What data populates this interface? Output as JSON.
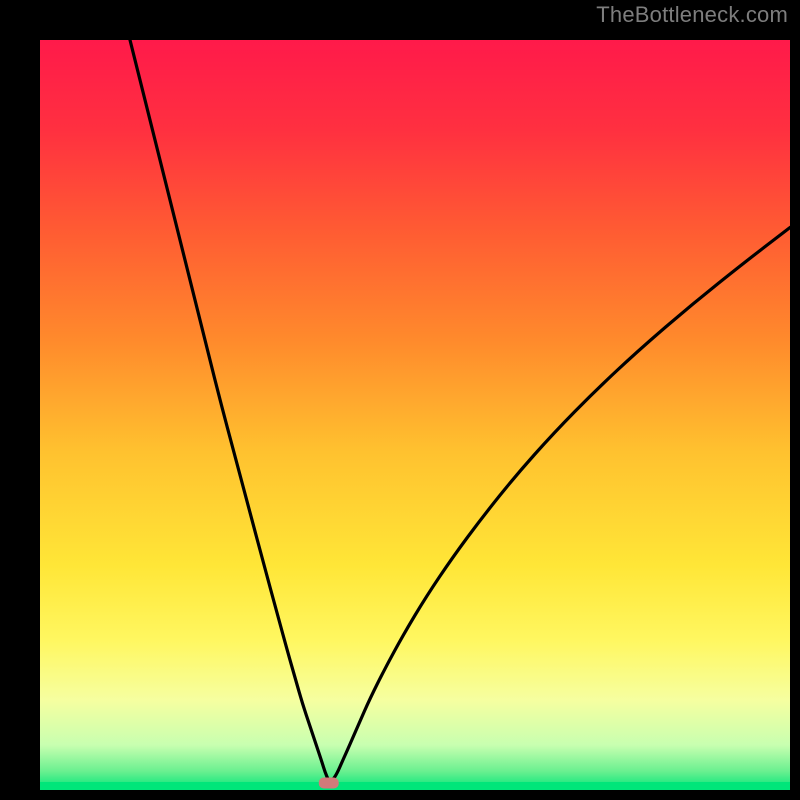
{
  "watermark": "TheBottleneck.com",
  "chart_data": {
    "type": "line",
    "title": "",
    "xlabel": "",
    "ylabel": "",
    "xlim": [
      0,
      100
    ],
    "ylim": [
      0,
      100
    ],
    "axes_visible": false,
    "background_gradient": {
      "stops": [
        {
          "offset": 0.0,
          "color": "#ff1a4a"
        },
        {
          "offset": 0.12,
          "color": "#ff3040"
        },
        {
          "offset": 0.25,
          "color": "#ff5a33"
        },
        {
          "offset": 0.4,
          "color": "#ff8a2c"
        },
        {
          "offset": 0.55,
          "color": "#ffc22f"
        },
        {
          "offset": 0.7,
          "color": "#ffe637"
        },
        {
          "offset": 0.8,
          "color": "#fff760"
        },
        {
          "offset": 0.88,
          "color": "#f6ffa0"
        },
        {
          "offset": 0.94,
          "color": "#c8ffb0"
        },
        {
          "offset": 0.975,
          "color": "#6af090"
        },
        {
          "offset": 1.0,
          "color": "#00e67a"
        }
      ]
    },
    "marker": {
      "x": 38.5,
      "y": 1.0,
      "color": "#d27a7a"
    },
    "series": [
      {
        "name": "bottleneck-curve",
        "x": [
          12.0,
          14.0,
          16.0,
          18.0,
          20.0,
          22.0,
          24.0,
          26.0,
          28.0,
          30.0,
          31.5,
          33.0,
          34.0,
          35.0,
          36.0,
          37.0,
          37.6,
          38.0,
          38.5,
          39.0,
          39.6,
          40.3,
          41.2,
          42.5,
          44.0,
          46.0,
          48.5,
          51.5,
          55.0,
          59.0,
          63.5,
          68.5,
          74.0,
          80.0,
          87.0,
          94.0,
          100.0
        ],
        "y": [
          100.0,
          92.0,
          84.0,
          76.0,
          68.0,
          60.0,
          52.0,
          44.5,
          37.0,
          29.5,
          24.0,
          18.5,
          15.0,
          11.5,
          8.5,
          5.5,
          3.7,
          2.4,
          1.2,
          1.3,
          2.2,
          3.8,
          5.8,
          8.8,
          12.2,
          16.2,
          20.8,
          25.8,
          31.0,
          36.4,
          42.0,
          47.6,
          53.2,
          58.8,
          64.8,
          70.4,
          75.0
        ]
      }
    ]
  }
}
